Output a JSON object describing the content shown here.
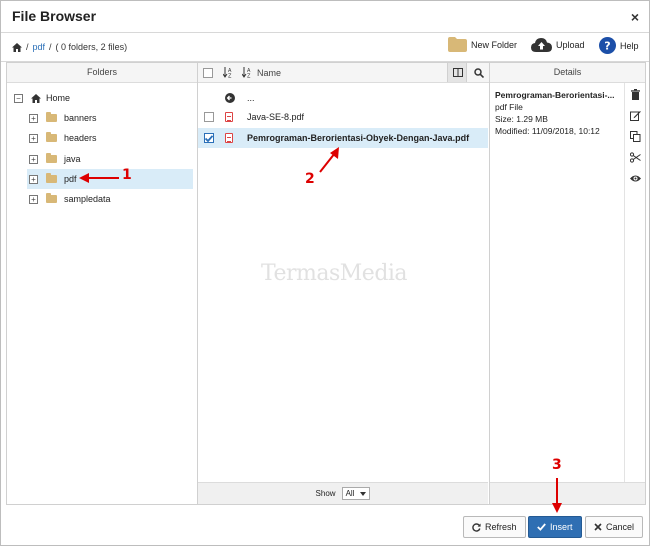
{
  "dialog": {
    "title": "File Browser",
    "close_symbol": "×"
  },
  "toolbar": {
    "breadcrumb_sep1": "/",
    "breadcrumb_link": "pdf",
    "breadcrumb_sep2": "/",
    "breadcrumb_info": "( 0 folders, 2 files)",
    "new_folder": "New Folder",
    "upload": "Upload",
    "help": "Help"
  },
  "folders_pane": {
    "header": "Folders",
    "root": "Home",
    "items": [
      {
        "label": "banners"
      },
      {
        "label": "headers"
      },
      {
        "label": "java"
      },
      {
        "label": "pdf",
        "selected": true
      },
      {
        "label": "sampledata"
      }
    ]
  },
  "files_pane": {
    "header_name": "Name",
    "parent_label": "...",
    "files": [
      {
        "name": "Java-SE-8.pdf",
        "selected": false
      },
      {
        "name": "Pemrograman-Berorientasi-Obyek-Dengan-Java.pdf",
        "selected": true
      }
    ],
    "footer_show": "Show",
    "footer_select": "All"
  },
  "details_pane": {
    "header": "Details",
    "name": "Pemrograman-Berorientasi-...",
    "type": "pdf File",
    "size": "Size: 1.29 MB",
    "modified": "Modified: 11/09/2018, 10:12"
  },
  "buttons": {
    "refresh": "Refresh",
    "insert": "Insert",
    "cancel": "Cancel"
  },
  "annotations": [
    "1",
    "2",
    "3"
  ],
  "watermark": "TermasMedia",
  "colors": {
    "accent": "#2f6fb3",
    "selection": "#d9ecf8",
    "annotation": "#dd0000",
    "folder": "#d8b877"
  }
}
